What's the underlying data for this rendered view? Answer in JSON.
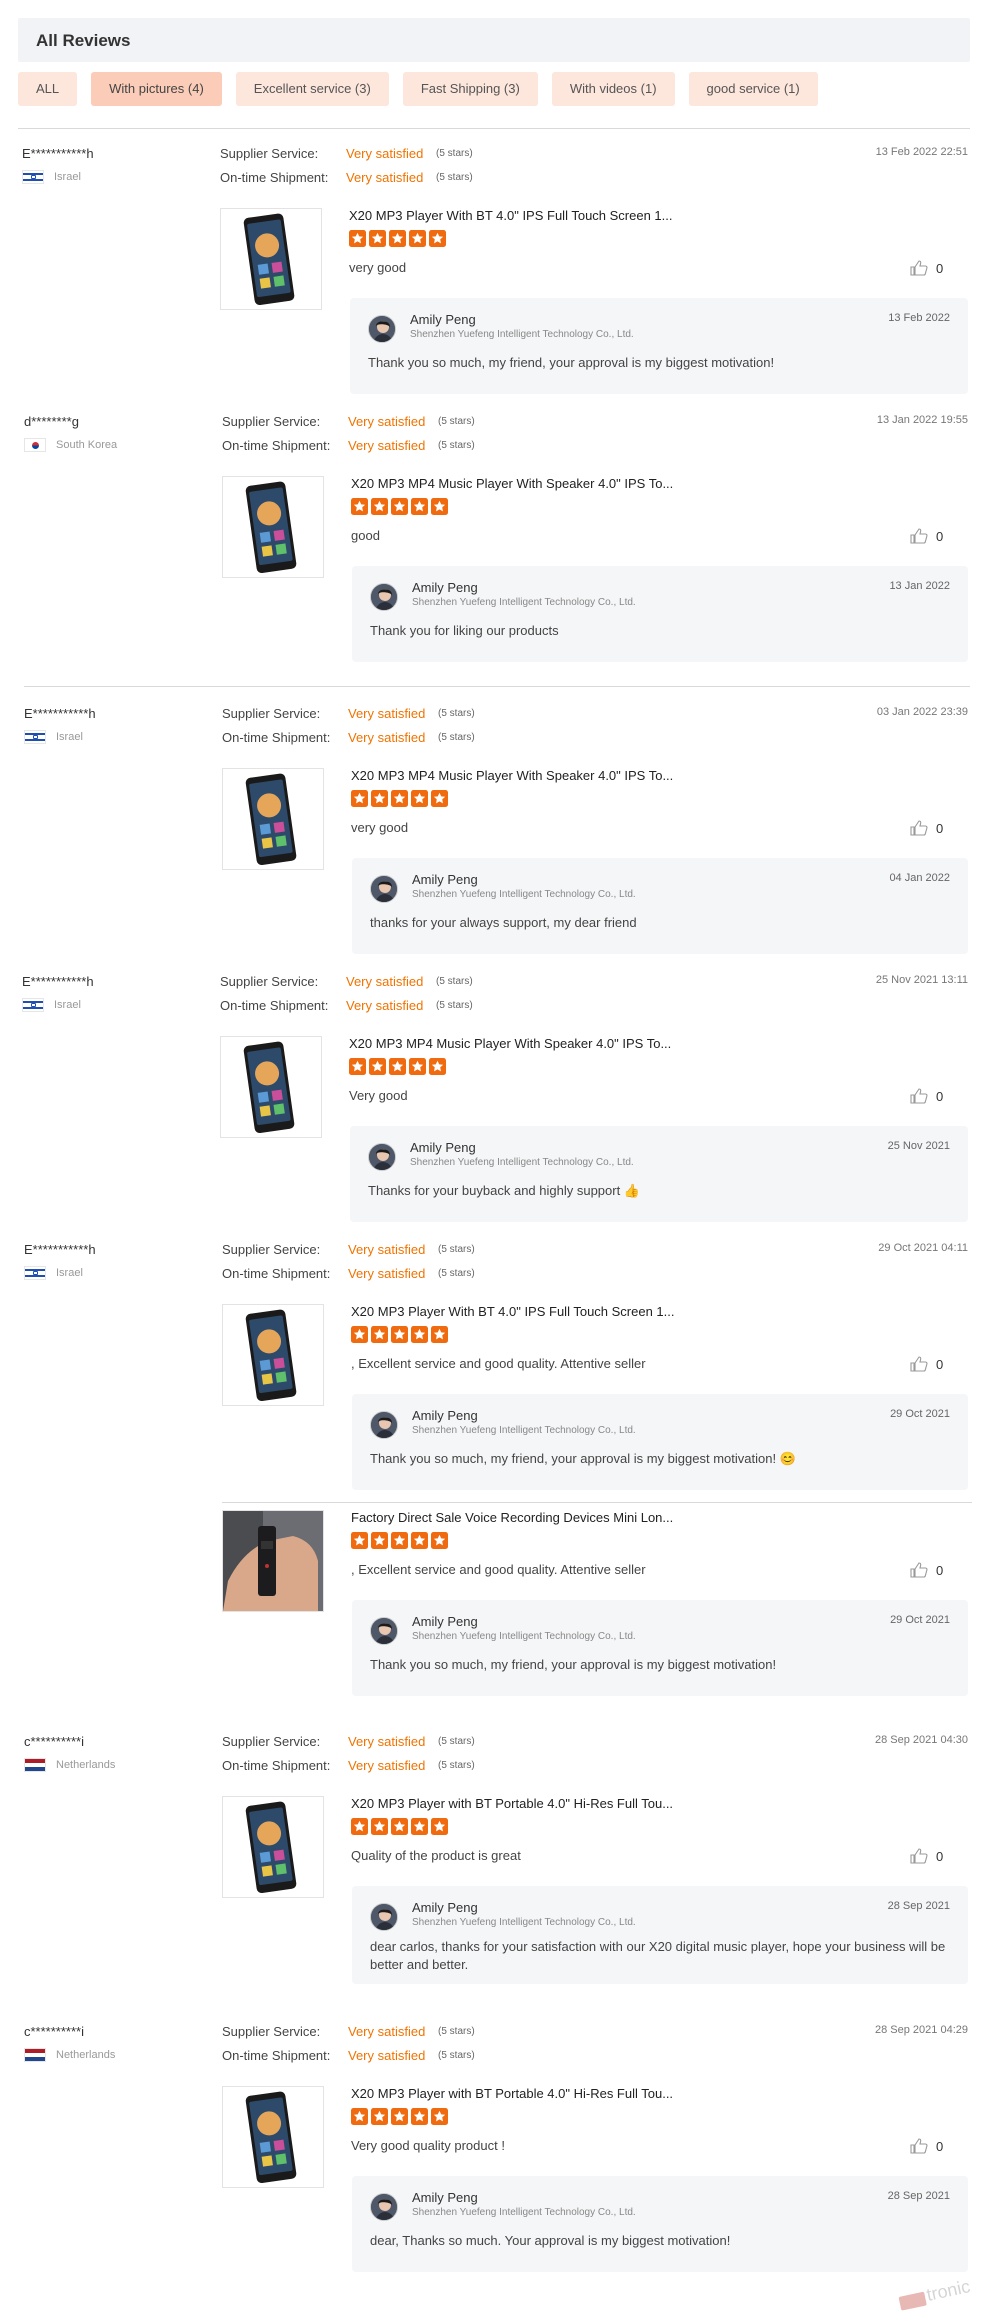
{
  "header": {
    "title": "All Reviews"
  },
  "filters": [
    {
      "label": "ALL",
      "active": false
    },
    {
      "label": "With pictures (4)",
      "active": true
    },
    {
      "label": "Excellent service (3)",
      "active": false
    },
    {
      "label": "Fast Shipping (3)",
      "active": false
    },
    {
      "label": "With videos (1)",
      "active": false
    },
    {
      "label": "good service (1)",
      "active": false
    }
  ],
  "labels": {
    "supplier_service": "Supplier Service:",
    "ontime_shipment": "On-time Shipment:",
    "very_satisfied": "Very satisfied",
    "five_stars": "(5 stars)"
  },
  "reply_common": {
    "name": "Amily Peng",
    "company": "Shenzhen Yuefeng Intelligent Technology Co., Ltd."
  },
  "reviews": [
    {
      "user": "E***********h",
      "country": "Israel",
      "date": "13 Feb 2022 22:51",
      "product": "X20 MP3 Player With BT 4.0\" IPS Full Touch Screen 1...",
      "rating": 5,
      "text": "very good",
      "likes": "0",
      "reply": {
        "date": "13 Feb 2022",
        "text": "Thank you so much, my friend, your approval is my biggest motivation!"
      }
    },
    {
      "user": "d********g",
      "country": "South Korea",
      "date": "13 Jan 2022 19:55",
      "product": "X20 MP3 MP4 Music Player With Speaker 4.0\" IPS To...",
      "rating": 5,
      "text": "good",
      "likes": "0",
      "reply": {
        "date": "13 Jan 2022",
        "text": "Thank you for liking our products"
      }
    },
    {
      "user": "E***********h",
      "country": "Israel",
      "date": "03 Jan 2022 23:39",
      "product": "X20 MP3 MP4 Music Player With Speaker 4.0\" IPS To...",
      "rating": 5,
      "text": "very good",
      "likes": "0",
      "reply": {
        "date": "04 Jan 2022",
        "text": "thanks for your always support, my dear friend"
      }
    },
    {
      "user": "E***********h",
      "country": "Israel",
      "date": "25 Nov 2021 13:11",
      "product": "X20 MP3 MP4 Music Player With Speaker 4.0\" IPS To...",
      "rating": 5,
      "text": "Very good",
      "likes": "0",
      "reply": {
        "date": "25 Nov 2021",
        "text": "Thanks for your buyback and highly support 👍"
      }
    },
    {
      "user": "E***********h",
      "country": "Israel",
      "date": "29 Oct 2021 04:11",
      "product": "X20 MP3 Player With BT 4.0\" IPS Full Touch Screen 1...",
      "rating": 5,
      "text": ", Excellent service and good quality.  Attentive seller",
      "likes": "0",
      "reply": {
        "date": "29 Oct 2021",
        "text": "Thank you so much, my friend, your approval is my biggest motivation! 😊"
      }
    },
    {
      "user": "",
      "country": "",
      "date": "",
      "product": "Factory Direct Sale Voice Recording Devices Mini Lon...",
      "rating": 5,
      "text": ", Excellent service and good quality.  Attentive seller",
      "likes": "0",
      "reply": {
        "date": "29 Oct 2021",
        "text": "Thank you so much, my friend, your approval is my biggest motivation!"
      }
    },
    {
      "user": "c**********i",
      "country": "Netherlands",
      "date": "28 Sep 2021 04:30",
      "product": "X20 MP3 Player with BT Portable 4.0\" Hi-Res Full Tou...",
      "rating": 5,
      "text": "Quality of the product is great",
      "likes": "0",
      "reply": {
        "date": "28 Sep 2021",
        "text": "dear carlos, thanks for your satisfaction with our X20 digital music player, hope your business will be better and better."
      }
    },
    {
      "user": "c**********i",
      "country": "Netherlands",
      "date": "28 Sep 2021 04:29",
      "product": "X20 MP3 Player with BT Portable 4.0\" Hi-Res Full Tou...",
      "rating": 5,
      "text": "Very good quality product !",
      "likes": "0",
      "reply": {
        "date": "28 Sep 2021",
        "text": "dear, Thanks so much. Your approval is my biggest motivation!"
      }
    }
  ],
  "watermark": "tronic",
  "colors": {
    "accent": "#f07300",
    "star": "#f06a0f",
    "filter_bg": "#fde6dc",
    "reply_bg": "#f5f6f8"
  }
}
